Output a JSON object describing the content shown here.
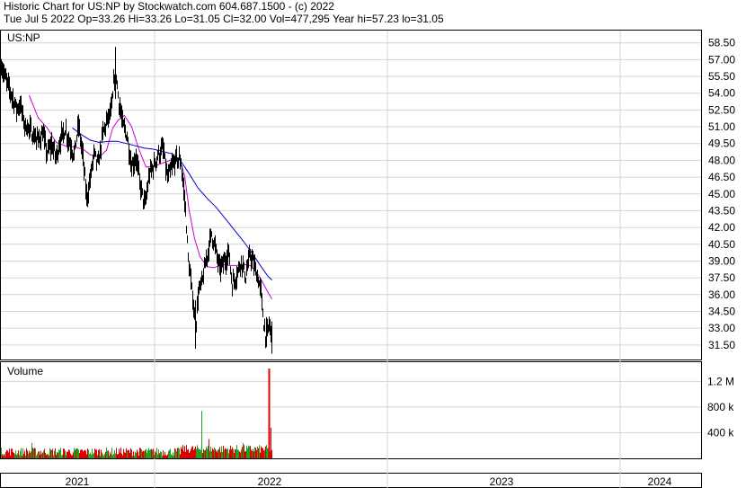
{
  "header": {
    "line1": "Historic Chart for US:NP by Stockwatch.com 604.687.1500 - (c) 2022",
    "line2": "Tue Jul  5 2022   Op=33.26   Hi=33.26   Lo=31.05   Cl=32.00   Vol=477,295   Year hi=57.23   lo=31.05"
  },
  "chart_data": [
    {
      "type": "line",
      "symbol_label": "US:NP",
      "y_ticks": [
        "58.50",
        "57.00",
        "55.50",
        "54.00",
        "52.50",
        "51.00",
        "49.50",
        "48.00",
        "46.50",
        "45.00",
        "43.50",
        "42.00",
        "40.50",
        "39.00",
        "37.50",
        "36.00",
        "34.50",
        "33.00",
        "31.50"
      ],
      "ylim": [
        30.2,
        59.6
      ],
      "x_labels": [
        "2021",
        "2022",
        "2023",
        "2024"
      ],
      "series": [
        {
          "style": "price-bars",
          "color": "#000000",
          "close_points": [
            [
              0,
              56.8
            ],
            [
              6,
              55.2
            ],
            [
              12,
              54.0
            ],
            [
              18,
              52.6
            ],
            [
              22,
              53.0
            ],
            [
              27,
              51.2
            ],
            [
              32,
              50.8
            ],
            [
              37,
              50.2
            ],
            [
              42,
              49.8
            ],
            [
              47,
              50.4
            ],
            [
              52,
              48.6
            ],
            [
              57,
              49.4
            ],
            [
              62,
              48.3
            ],
            [
              67,
              49.9
            ],
            [
              72,
              50.8
            ],
            [
              77,
              49.6
            ],
            [
              82,
              48.5
            ],
            [
              87,
              51.2
            ],
            [
              92,
              48.2
            ],
            [
              96,
              44.6
            ],
            [
              100,
              46.3
            ],
            [
              104,
              48.6
            ],
            [
              109,
              47.6
            ],
            [
              114,
              50.4
            ],
            [
              119,
              51.6
            ],
            [
              124,
              52.6
            ],
            [
              128,
              56.7
            ],
            [
              131,
              53.8
            ],
            [
              136,
              51.2
            ],
            [
              141,
              50.2
            ],
            [
              146,
              47.4
            ],
            [
              151,
              48.3
            ],
            [
              156,
              45.6
            ],
            [
              161,
              44.0
            ],
            [
              166,
              46.8
            ],
            [
              171,
              47.6
            ],
            [
              176,
              48.6
            ],
            [
              181,
              49.0
            ],
            [
              186,
              46.3
            ],
            [
              191,
              47.4
            ],
            [
              196,
              48.2
            ],
            [
              201,
              47.9
            ],
            [
              206,
              43.6
            ],
            [
              209,
              39.2
            ],
            [
              212,
              37.0
            ],
            [
              215,
              35.1
            ],
            [
              217,
              32.4
            ],
            [
              220,
              36.0
            ],
            [
              225,
              37.3
            ],
            [
              230,
              39.5
            ],
            [
              235,
              41.5
            ],
            [
              239,
              40.2
            ],
            [
              244,
              38.3
            ],
            [
              249,
              38.9
            ],
            [
              254,
              39.8
            ],
            [
              258,
              36.9
            ],
            [
              263,
              37.8
            ],
            [
              268,
              39.1
            ],
            [
              273,
              37.6
            ],
            [
              278,
              39.6
            ],
            [
              283,
              38.4
            ],
            [
              287,
              37.3
            ],
            [
              290,
              36.2
            ],
            [
              293,
              33.4
            ],
            [
              296,
              32.1
            ],
            [
              299,
              33.4
            ],
            [
              302,
              32.0
            ]
          ]
        },
        {
          "style": "moving-average",
          "color": "#cc00cc",
          "points": [
            [
              32,
              53.8
            ],
            [
              42,
              51.8
            ],
            [
              52,
              50.9
            ],
            [
              62,
              49.6
            ],
            [
              72,
              49.3
            ],
            [
              82,
              49.2
            ],
            [
              92,
              49.0
            ],
            [
              100,
              48.5
            ],
            [
              110,
              48.3
            ],
            [
              118,
              48.9
            ],
            [
              125,
              50.9
            ],
            [
              131,
              51.6
            ],
            [
              138,
              52.0
            ],
            [
              146,
              51.0
            ],
            [
              154,
              49.0
            ],
            [
              162,
              47.4
            ],
            [
              172,
              47.5
            ],
            [
              182,
              47.8
            ],
            [
              192,
              48.1
            ],
            [
              199,
              48.2
            ],
            [
              205,
              46.6
            ],
            [
              210,
              43.5
            ],
            [
              216,
              41.0
            ],
            [
              222,
              39.4
            ],
            [
              230,
              38.5
            ],
            [
              238,
              38.4
            ],
            [
              246,
              38.7
            ],
            [
              254,
              38.6
            ],
            [
              262,
              38.6
            ],
            [
              270,
              38.7
            ],
            [
              278,
              38.6
            ],
            [
              285,
              38.0
            ],
            [
              291,
              37.2
            ],
            [
              297,
              36.3
            ],
            [
              302,
              35.6
            ]
          ]
        },
        {
          "style": "moving-average",
          "color": "#0000cc",
          "points": [
            [
              80,
              50.9
            ],
            [
              90,
              50.3
            ],
            [
              100,
              49.8
            ],
            [
              110,
              49.6
            ],
            [
              120,
              49.7
            ],
            [
              130,
              49.7
            ],
            [
              140,
              49.5
            ],
            [
              150,
              49.3
            ],
            [
              160,
              49.1
            ],
            [
              170,
              49.0
            ],
            [
              180,
              48.8
            ],
            [
              190,
              48.6
            ],
            [
              200,
              48.0
            ],
            [
              210,
              46.8
            ],
            [
              220,
              45.5
            ],
            [
              230,
              44.6
            ],
            [
              240,
              43.8
            ],
            [
              250,
              42.8
            ],
            [
              260,
              41.8
            ],
            [
              270,
              40.8
            ],
            [
              280,
              39.7
            ],
            [
              290,
              38.5
            ],
            [
              297,
              37.7
            ],
            [
              302,
              37.3
            ]
          ]
        }
      ]
    },
    {
      "type": "bar",
      "title": "Volume",
      "y_ticks": [
        "1.2 M",
        "800 k",
        "400 k"
      ],
      "y_tick_values": [
        1200000,
        800000,
        400000
      ],
      "ylim": [
        0,
        1500000
      ],
      "series": [
        {
          "name": "up-days",
          "color": "#22a022"
        },
        {
          "name": "down-days",
          "color": "#dd0000"
        }
      ],
      "highlights": [
        {
          "x": 35,
          "value": 240000,
          "color": "#22a022"
        },
        {
          "x": 224,
          "value": 740000,
          "color": "#22a022"
        },
        {
          "x": 232,
          "value": 300000,
          "color": "#dd0000"
        },
        {
          "x": 270,
          "value": 240000,
          "color": "#22a022"
        },
        {
          "x": 299,
          "value": 1400000,
          "color": "#dd0000"
        },
        {
          "x": 301,
          "value": 480000,
          "color": "#dd0000"
        }
      ]
    }
  ]
}
